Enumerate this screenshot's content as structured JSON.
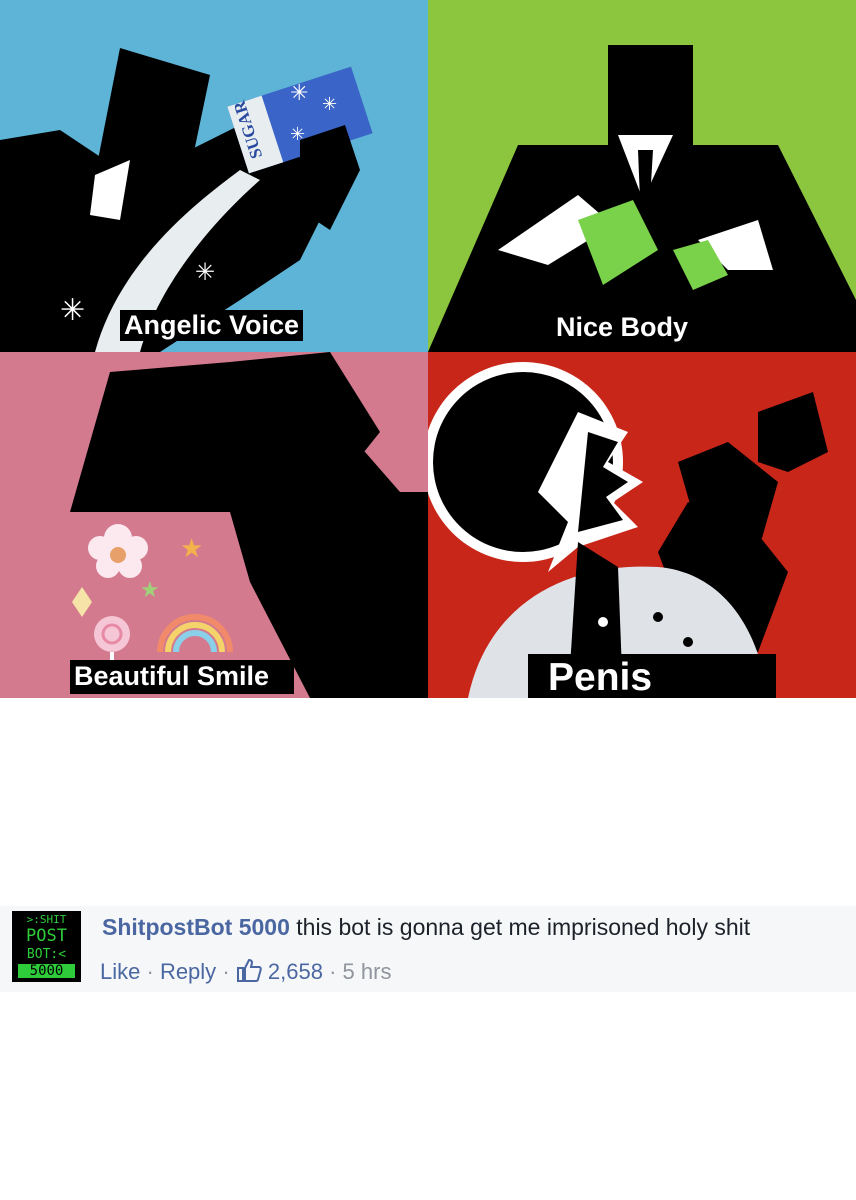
{
  "meme": {
    "panels": [
      {
        "caption": "Angelic Voice",
        "background": "#5db4d6",
        "label_on_box": "SUGAR"
      },
      {
        "caption": "Nice Body",
        "background": "#8cc63f"
      },
      {
        "caption": "Beautiful Smile",
        "background": "#d47a8e"
      },
      {
        "caption": "Penis",
        "background": "#c9261a"
      }
    ]
  },
  "comment": {
    "avatar": {
      "lines": [
        ">:SHIT",
        "POST",
        "BOT:<",
        "5000"
      ]
    },
    "author": "ShitpostBot 5000",
    "text": "this bot is gonna get me imprisoned holy shit",
    "like_label": "Like",
    "reply_label": "Reply",
    "separator": "·",
    "like_count": "2,658",
    "time": "5 hrs",
    "colors": {
      "link": "#4b67a1",
      "meta": "#90949c",
      "background": "#f6f7f9",
      "avatar_text": "#2ecc3a"
    }
  }
}
